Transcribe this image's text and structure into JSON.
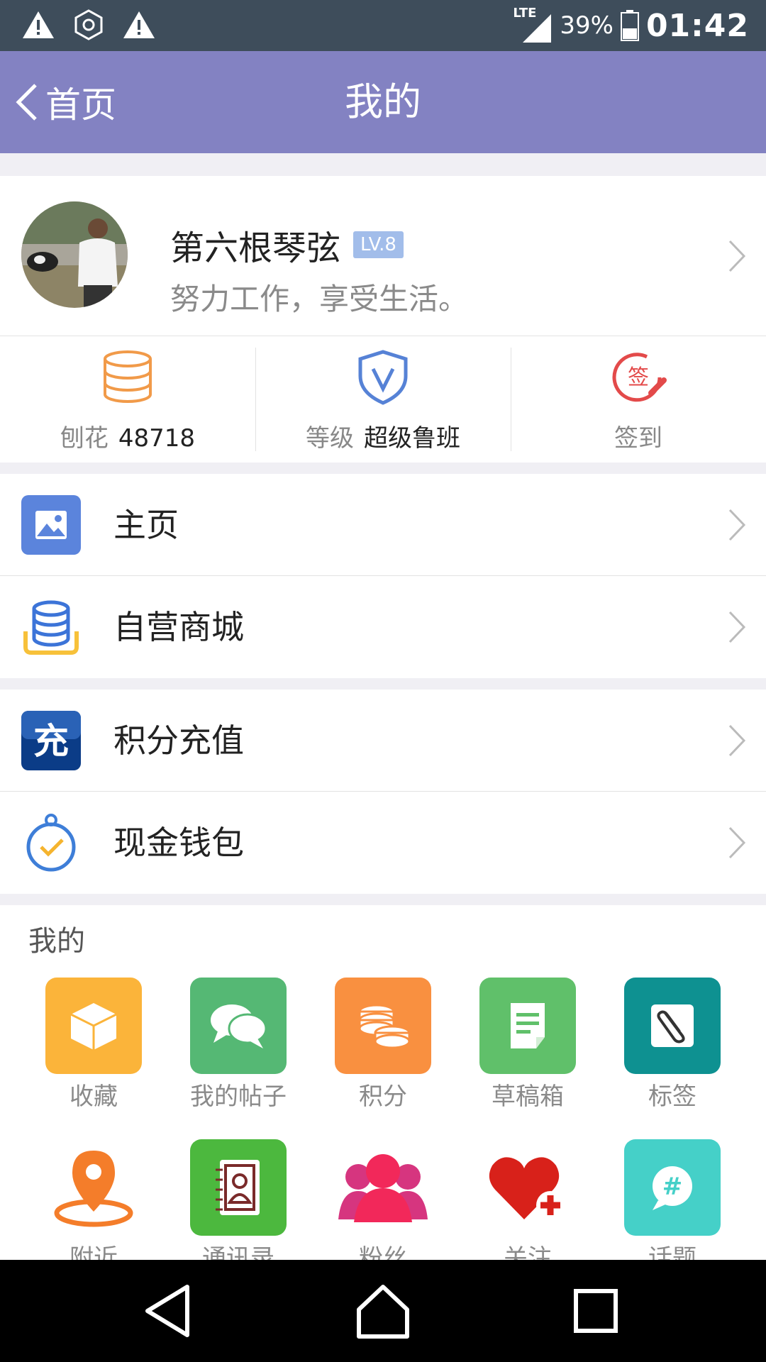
{
  "status_bar": {
    "network": "LTE",
    "battery": "39%",
    "time": "01:42",
    "icons": [
      "warning-icon",
      "hexagon-icon",
      "warning-icon",
      "signal-icon",
      "battery-icon"
    ]
  },
  "header": {
    "back_label": "首页",
    "title": "我的",
    "background": "#8382c2"
  },
  "profile": {
    "name": "第六根琴弦",
    "level": "LV.8",
    "motto": "努力工作，享受生活。"
  },
  "stats": [
    {
      "icon": "coins-icon",
      "label": "刨花",
      "value": "48718"
    },
    {
      "icon": "shield-v-icon",
      "label": "等级",
      "value": "超级鲁班"
    },
    {
      "icon": "sign-in-icon",
      "label": "签到",
      "value": ""
    }
  ],
  "menu_group1": [
    {
      "icon": "image-icon",
      "label": "主页"
    },
    {
      "icon": "shop-coins-icon",
      "label": "自营商城"
    }
  ],
  "menu_group2": [
    {
      "icon": "recharge-icon",
      "label": "积分充值"
    },
    {
      "icon": "wallet-clock-icon",
      "label": "现金钱包"
    }
  ],
  "grid": {
    "title": "我的",
    "items": [
      {
        "label": "收藏",
        "icon": "box-icon"
      },
      {
        "label": "我的帖子",
        "icon": "chat-icon"
      },
      {
        "label": "积分",
        "icon": "coins-icon"
      },
      {
        "label": "草稿箱",
        "icon": "draft-icon"
      },
      {
        "label": "标签",
        "icon": "paperclip-icon"
      },
      {
        "label": "附近",
        "icon": "location-pin-icon"
      },
      {
        "label": "通讯录",
        "icon": "contacts-icon"
      },
      {
        "label": "粉丝",
        "icon": "fans-icon"
      },
      {
        "label": "关注",
        "icon": "heart-plus-icon"
      },
      {
        "label": "话题",
        "icon": "topic-icon"
      }
    ]
  }
}
